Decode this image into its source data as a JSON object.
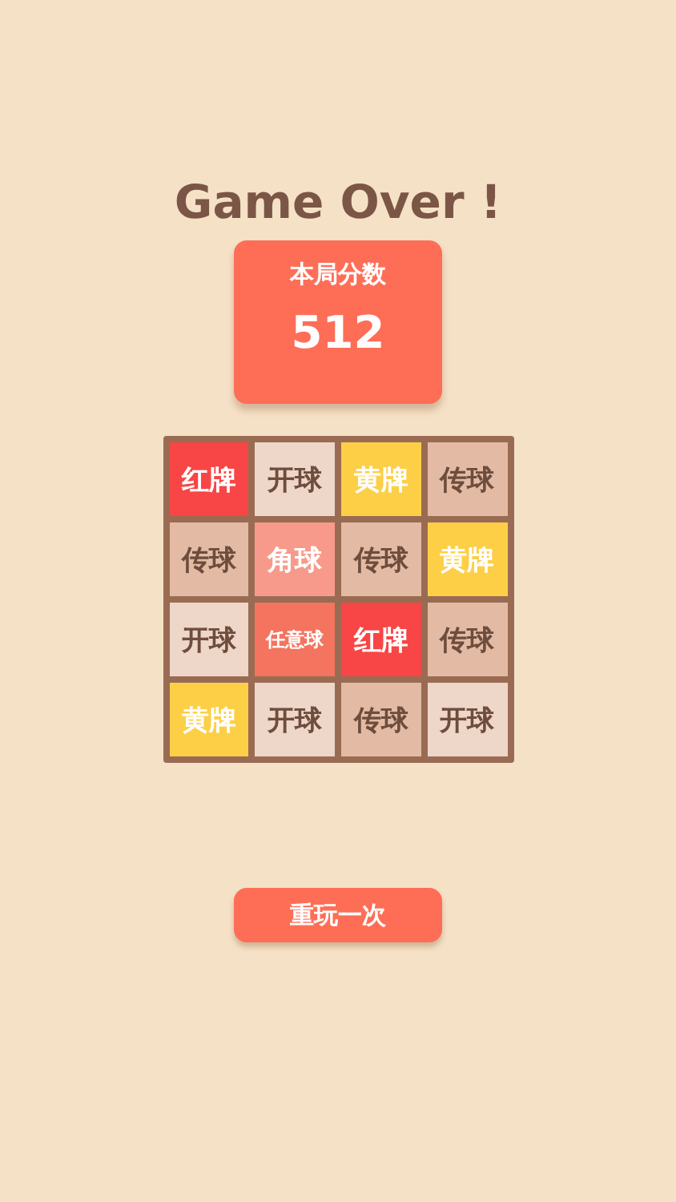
{
  "title": "Game Over !",
  "score": {
    "label": "本局分数",
    "value": "512"
  },
  "board": {
    "tiles": [
      {
        "label": "红牌",
        "kind": "card",
        "color": "#f84545"
      },
      {
        "label": "开球",
        "kind": "plain",
        "color": "#eed6c9"
      },
      {
        "label": "黄牌",
        "kind": "card",
        "color": "#fdcf47"
      },
      {
        "label": "传球",
        "kind": "plain",
        "color": "#e3bba5"
      },
      {
        "label": "传球",
        "kind": "plain",
        "color": "#e3bba5"
      },
      {
        "label": "角球",
        "kind": "card",
        "color": "#f79a8b"
      },
      {
        "label": "传球",
        "kind": "plain",
        "color": "#e3bba5"
      },
      {
        "label": "黄牌",
        "kind": "card",
        "color": "#fdcf47"
      },
      {
        "label": "开球",
        "kind": "plain",
        "color": "#eed6c9"
      },
      {
        "label": "任意球",
        "kind": "small",
        "color": "#f4745f"
      },
      {
        "label": "红牌",
        "kind": "card",
        "color": "#f84545"
      },
      {
        "label": "传球",
        "kind": "plain",
        "color": "#e3bba5"
      },
      {
        "label": "黄牌",
        "kind": "card",
        "color": "#fdcf47"
      },
      {
        "label": "开球",
        "kind": "plain",
        "color": "#eed6c9"
      },
      {
        "label": "传球",
        "kind": "plain",
        "color": "#e3bba5"
      },
      {
        "label": "开球",
        "kind": "plain",
        "color": "#eed6c9"
      }
    ]
  },
  "replay_button": "重玩一次"
}
